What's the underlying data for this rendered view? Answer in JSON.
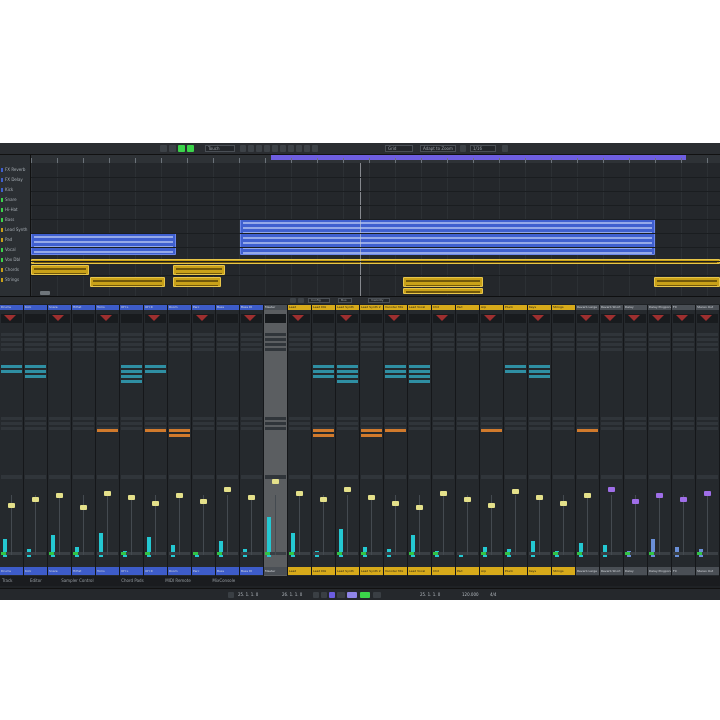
{
  "toolbar": {
    "selectors": [
      "Touch",
      "Grid",
      "Adapt to Zoom",
      "1/16"
    ]
  },
  "tracks": [
    {
      "label": "FX Reverb"
    },
    {
      "label": "FX Delay"
    },
    {
      "label": "Kick"
    },
    {
      "label": "Snare"
    },
    {
      "label": "Hi-Hat"
    },
    {
      "label": "Bass"
    },
    {
      "label": "Lead Synth"
    },
    {
      "label": "Pad"
    },
    {
      "label": "Vocal"
    },
    {
      "label": "Vox Dbl"
    },
    {
      "label": "Chords"
    },
    {
      "label": "Strings"
    }
  ],
  "mixer_toolbar": {
    "labels": [
      "Config",
      "Bus",
      "Visibility"
    ]
  },
  "channels": [
    {
      "name": "Drums",
      "color": "blue"
    },
    {
      "name": "Kick",
      "color": "blue"
    },
    {
      "name": "Snare",
      "color": "blue"
    },
    {
      "name": "HiHat",
      "color": "blue"
    },
    {
      "name": "Toms",
      "color": "blue"
    },
    {
      "name": "OH L",
      "color": "blue"
    },
    {
      "name": "OH R",
      "color": "blue"
    },
    {
      "name": "Room",
      "color": "blue"
    },
    {
      "name": "Perc",
      "color": "blue"
    },
    {
      "name": "Bass",
      "color": "blue"
    },
    {
      "name": "Bass DI",
      "color": "blue"
    },
    {
      "name": "Master",
      "color": "grey"
    },
    {
      "name": "Lead",
      "color": "yellow"
    },
    {
      "name": "Lead Dbl",
      "color": "yellow"
    },
    {
      "name": "Lead Synth",
      "color": "yellow"
    },
    {
      "name": "Lead Synth 2",
      "color": "yellow"
    },
    {
      "name": "Vocoder Mix",
      "color": "yellow"
    },
    {
      "name": "Lead Vocal",
      "color": "yellow"
    },
    {
      "name": "Chd",
      "color": "yellow"
    },
    {
      "name": "Pad",
      "color": "yellow"
    },
    {
      "name": "Arp",
      "color": "yellow"
    },
    {
      "name": "Pluck",
      "color": "yellow"
    },
    {
      "name": "Keys",
      "color": "yellow"
    },
    {
      "name": "Strings",
      "color": "yellow"
    },
    {
      "name": "Reverb Large",
      "color": "grey"
    },
    {
      "name": "Reverb Short",
      "color": "grey"
    },
    {
      "name": "Delay",
      "color": "grey"
    },
    {
      "name": "Delay Pingpong",
      "color": "grey"
    },
    {
      "name": "FX",
      "color": "grey"
    },
    {
      "name": "Stereo Out",
      "color": "grey"
    }
  ],
  "bottom_tabs": [
    "Track",
    "Editor",
    "Sampler Control",
    "Chord Pads",
    "MIDI Remote",
    "MixConsole"
  ],
  "transport": {
    "position": "25. 1. 1. 0",
    "end": "26. 1. 1. 0",
    "tempo": "120.000",
    "signature": "4/4"
  },
  "colors": {
    "clip_blue": "#3f5fcf",
    "clip_yellow": "#c9a118",
    "cycle": "#6e5ee0",
    "meter": "#24c8d2",
    "active_green": "#3bd44a"
  }
}
